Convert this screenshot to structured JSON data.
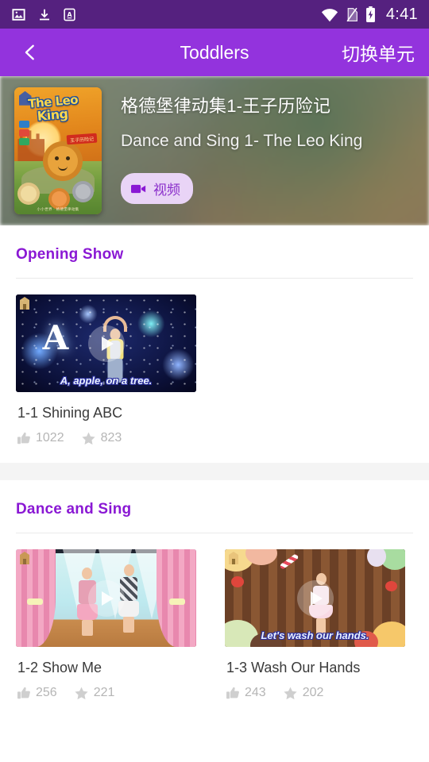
{
  "statusbar": {
    "time": "4:41",
    "icons": [
      "image-icon",
      "download-icon",
      "translate-a-icon",
      "wifi-icon",
      "no-sim-icon",
      "battery-charging-icon"
    ]
  },
  "appbar": {
    "back_icon": "chevron-left-icon",
    "title": "Toddlers",
    "action_label": "切换单元"
  },
  "hero": {
    "cover": {
      "title_line1": "The Leo",
      "title_line2": "King",
      "subtitle_badge": "王子历险记",
      "footer": "小小世界 · 格德堡律动集"
    },
    "title_cn": "格德堡律动集1-王子历险记",
    "title_en": "Dance and Sing 1- The Leo King",
    "badge": {
      "icon": "video-camera-icon",
      "label": "视频"
    }
  },
  "sections": [
    {
      "title": "Opening Show",
      "items": [
        {
          "title": "1-1 Shining ABC",
          "caption": "A, apple, on a tree.",
          "letter": "A",
          "likes": "1022",
          "stars": "823",
          "art": "art-star"
        }
      ]
    },
    {
      "title": "Dance and Sing",
      "items": [
        {
          "title": "1-2 Show Me",
          "caption": "",
          "likes": "256",
          "stars": "221",
          "art": "art-stage"
        },
        {
          "title": "1-3 Wash Our Hands",
          "caption": "Let's wash our hands.",
          "likes": "243",
          "stars": "202",
          "art": "art-candy"
        }
      ]
    }
  ],
  "colors": {
    "statusbar_bg": "#55217f",
    "appbar_bg": "#9333dd",
    "section_title": "#8a18d4",
    "badge_bg": "#e9d4f6",
    "badge_text": "#8a2ecb",
    "stat_text": "#b5b5b5",
    "gap_band": "#f4f4f4"
  },
  "icons": {
    "thumbs_up": "thumbs-up-icon",
    "star": "star-icon",
    "play": "play-icon",
    "watermark": "app-watermark-icon"
  }
}
